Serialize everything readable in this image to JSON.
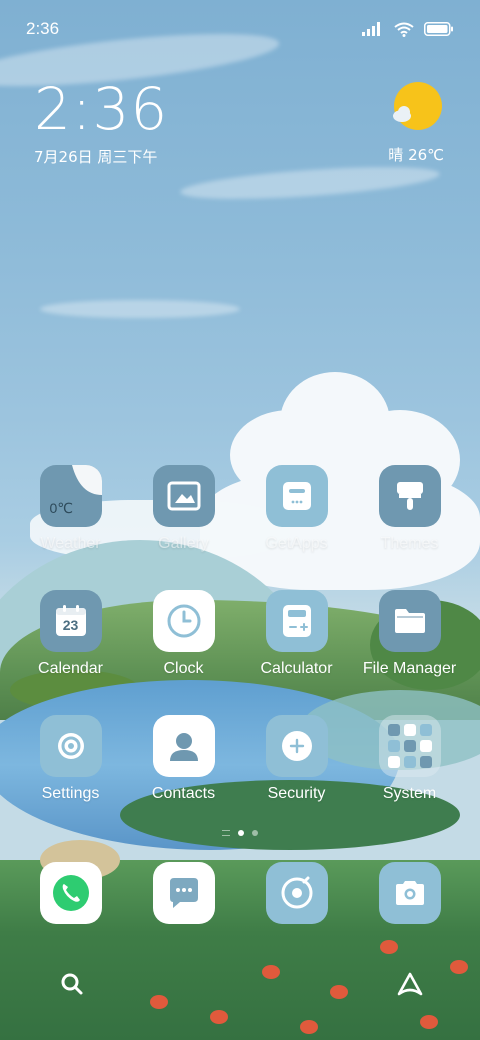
{
  "status_bar": {
    "time": "2:36"
  },
  "clock_widget": {
    "time": "2:36",
    "date": "7月26日 周三下午"
  },
  "weather_widget": {
    "text": "晴 26℃"
  },
  "home": {
    "rows": [
      [
        {
          "label": "Weather",
          "icon": "weather-icon",
          "temp": "0℃"
        },
        {
          "label": "Gallery",
          "icon": "gallery-icon"
        },
        {
          "label": "GetApps",
          "icon": "getapps-icon"
        },
        {
          "label": "Themes",
          "icon": "themes-icon"
        }
      ],
      [
        {
          "label": "Calendar",
          "icon": "calendar-icon",
          "day": "23"
        },
        {
          "label": "Clock",
          "icon": "clock-icon"
        },
        {
          "label": "Calculator",
          "icon": "calculator-icon"
        },
        {
          "label": "File Manager",
          "icon": "folder-icon"
        }
      ],
      [
        {
          "label": "Settings",
          "icon": "settings-icon"
        },
        {
          "label": "Contacts",
          "icon": "contacts-icon"
        },
        {
          "label": "Security",
          "icon": "security-icon"
        },
        {
          "label": "System",
          "icon": "folder-grid-icon"
        }
      ]
    ]
  },
  "dock": [
    {
      "icon": "phone-icon"
    },
    {
      "icon": "messages-icon"
    },
    {
      "icon": "browser-icon"
    },
    {
      "icon": "camera-icon"
    }
  ],
  "bottom": {
    "left_icon": "search-icon",
    "right_icon": "assistant-icon"
  }
}
